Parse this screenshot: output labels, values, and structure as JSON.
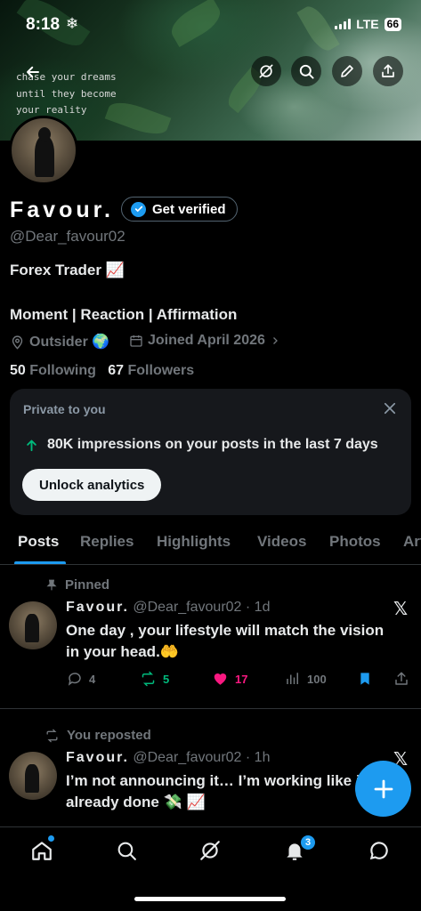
{
  "status_bar": {
    "time": "8:18",
    "network": "LTE",
    "battery": "66"
  },
  "banner": {
    "quote_lines": [
      "chase your dreams",
      "until they become",
      "your reality"
    ]
  },
  "header_icons": [
    "back-arrow-icon",
    "grok-icon",
    "search-icon",
    "edit-icon",
    "share-icon"
  ],
  "profile": {
    "display_name": "Favour.",
    "verify_label": "Get verified",
    "handle": "@Dear_favour02",
    "bio_line1": "Forex Trader 📈",
    "bio_line2": "Moment | Reaction | Affirmation",
    "location": "Outsider 🌍",
    "joined": "Joined April 2026",
    "following_count": "50",
    "following_label": "Following",
    "followers_count": "67",
    "followers_label": "Followers"
  },
  "analytics_card": {
    "title": "Private to you",
    "impressions": "80K impressions on your posts in the last 7 days",
    "button": "Unlock analytics"
  },
  "tabs": [
    {
      "label": "Posts",
      "active": true
    },
    {
      "label": "Replies"
    },
    {
      "label": "Highlights"
    },
    {
      "label": "Videos"
    },
    {
      "label": "Photos"
    },
    {
      "label": "Articles"
    }
  ],
  "posts": [
    {
      "context": "Pinned",
      "author": "Favour.",
      "meta": "@Dear_favour02 · 1d",
      "text_line1": "One day , your lifestyle will match the vision",
      "text_line2": "in your head.🤲",
      "replies": "4",
      "reposts": "5",
      "likes": "17",
      "views": "100"
    },
    {
      "context": "You reposted",
      "author": "Favour.",
      "meta": "@Dear_favour02 · 1h",
      "text_line1": "I’m not announcing it… I’m working like it’s",
      "text_line2": "already done 💸 📈"
    }
  ],
  "bottom_nav": {
    "items": [
      "home-icon",
      "search-icon",
      "grok-icon",
      "notifications-icon",
      "messages-icon"
    ],
    "notification_count": "3"
  },
  "colors": {
    "accent": "#1d9bf0",
    "like": "#f91880",
    "repost": "#00ba7c",
    "muted": "#71767b"
  }
}
